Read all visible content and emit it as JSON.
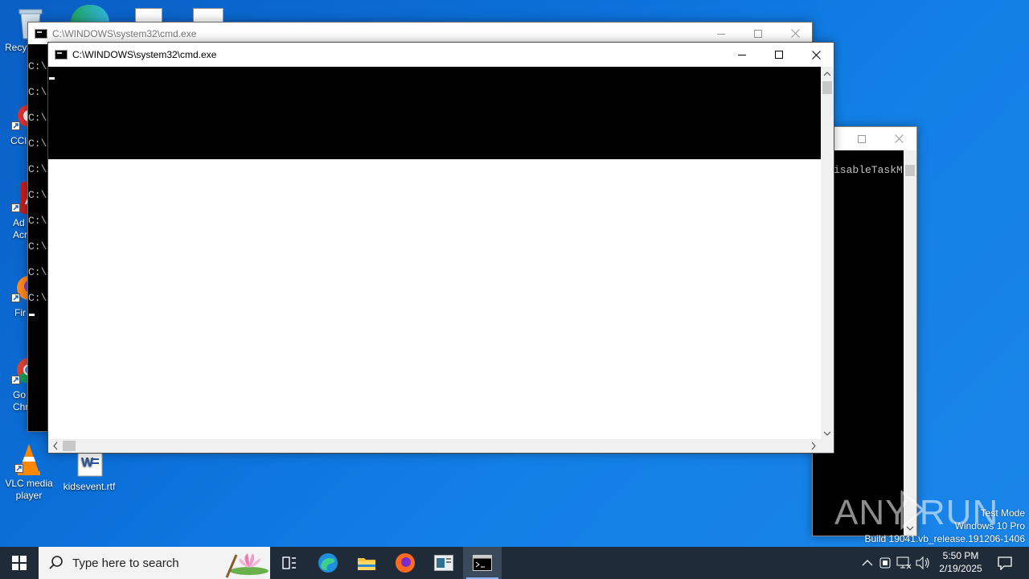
{
  "desktop": {
    "icons": [
      {
        "label": "Recy"
      },
      {
        "label": "CCl"
      },
      {
        "label": "Ad\nAcr"
      },
      {
        "label": "Fir"
      },
      {
        "label": "Go\nChr"
      },
      {
        "label": "VLC media player"
      },
      {
        "label": "kidsevent.rtf"
      }
    ],
    "watermark": {
      "logo": "ANY RUN",
      "lines": [
        "Test Mode",
        "Windows 10 Pro",
        "Build 19041.vb_release.191206-1406"
      ]
    }
  },
  "windows": {
    "back_cmd": {
      "title": "C:\\WINDOWS\\system32\\cmd.exe",
      "prompts": [
        "C:\\",
        "C:\\",
        "C:\\",
        "C:\\",
        "C:\\",
        "C:\\",
        "C:\\",
        "C:\\",
        "C:\\",
        "C:\\"
      ]
    },
    "right_cmd": {
      "text": "isableTaskM"
    },
    "front_cmd": {
      "title": "C:\\WINDOWS\\system32\\cmd.exe"
    }
  },
  "taskbar": {
    "search_placeholder": "Type here to search",
    "time": "5:50 PM",
    "date": "2/19/2025"
  }
}
